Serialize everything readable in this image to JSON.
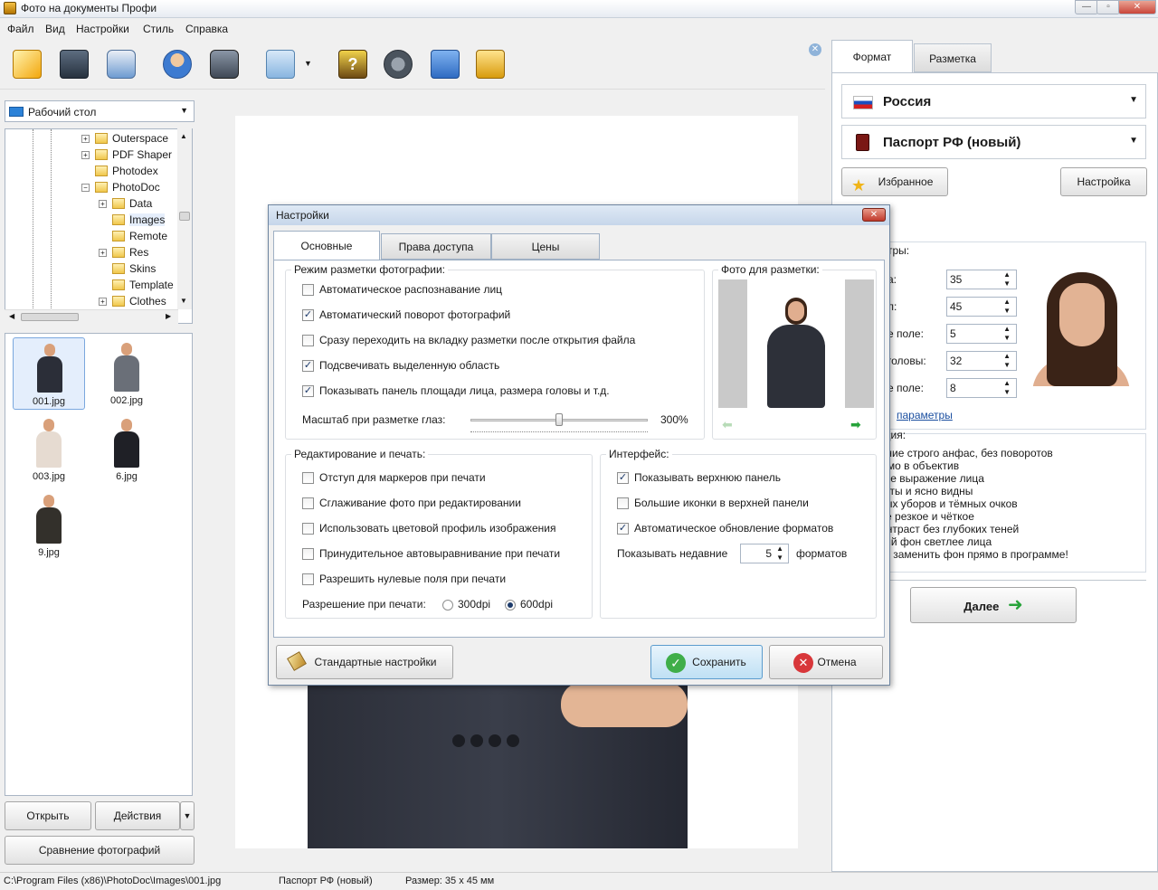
{
  "window": {
    "title": "Фото на документы Профи"
  },
  "menu": [
    "Файл",
    "Вид",
    "Настройки",
    "Стиль",
    "Справка"
  ],
  "toolbar_icons": [
    "open-icon",
    "save-icon",
    "print-icon",
    "user-icon",
    "camera-icon",
    "editor-icon",
    "help-icon",
    "video-icon",
    "home-icon",
    "cart-icon"
  ],
  "left": {
    "folder": "Рабочий стол",
    "tree": [
      {
        "label": "Outerspace",
        "level": 0,
        "expand": true
      },
      {
        "label": "PDF Shaper",
        "level": 0,
        "expand": true
      },
      {
        "label": "Photodex",
        "level": 0,
        "expand": false
      },
      {
        "label": "PhotoDoc",
        "level": 0,
        "expand": true,
        "open": true
      },
      {
        "label": "Data",
        "level": 1,
        "expand": true
      },
      {
        "label": "Images",
        "level": 1,
        "expand": false,
        "selected": true
      },
      {
        "label": "Remote",
        "level": 1,
        "expand": false
      },
      {
        "label": "Res",
        "level": 1,
        "expand": true
      },
      {
        "label": "Skins",
        "level": 1,
        "expand": false
      },
      {
        "label": "Template",
        "level": 1,
        "expand": false
      },
      {
        "label": "Clothes",
        "level": 1,
        "expand": true
      }
    ],
    "thumbs": [
      {
        "name": "001.jpg",
        "color": "#2b2e38"
      },
      {
        "name": "002.jpg",
        "color": "#6a6f78"
      },
      {
        "name": "003.jpg",
        "color": "#e6dbd1"
      },
      {
        "name": "6.jpg",
        "color": "#1f2026"
      },
      {
        "name": "9.jpg",
        "color": "#33302b"
      }
    ],
    "open_button": "Открыть",
    "actions_button": "Действия",
    "compare_button": "Сравнение фотографий"
  },
  "right": {
    "tab_format": "Формат",
    "tab_markup": "Разметка",
    "country": "Россия",
    "doc": "Паспорт РФ (новый)",
    "fav": "Избранное",
    "setup": "Настройка",
    "params_title": "тры:",
    "params": [
      {
        "label": "а:",
        "value": "35"
      },
      {
        "label": "л:",
        "value": "45"
      },
      {
        "label": "е поле:",
        "value": "5"
      },
      {
        "label": "головы:",
        "value": "32"
      },
      {
        "label": "е поле:",
        "value": "8"
      }
    ],
    "more_params": "параметры",
    "req_title": "ация:",
    "req_lines": [
      "ложение строго анфас, без поворотов",
      "д прямо в объектив",
      "альное выражение лица",
      "открыты и ясно видны",
      "ловных уборов и тёмных очков",
      "жение резкое и чёткое",
      "ий контраст без глубоких теней",
      "тонный фон светлее лица",
      "ожете заменить фон прямо в программе!"
    ],
    "next": "Далее"
  },
  "dialog": {
    "title": "Настройки",
    "tabs": [
      "Основные",
      "Права доступа",
      "Цены"
    ],
    "markup_group": "Режим разметки фотографии:",
    "markup_options": [
      {
        "label": "Автоматическое распознавание лиц",
        "checked": false
      },
      {
        "label": "Автоматический поворот фотографий",
        "checked": true
      },
      {
        "label": "Сразу переходить на вкладку разметки после открытия файла",
        "checked": false
      },
      {
        "label": "Подсвечивать выделенную область",
        "checked": true
      },
      {
        "label": "Показывать панель площади лица, размера головы и т.д.",
        "checked": true
      }
    ],
    "zoom_label": "Масштаб при разметке глаз:",
    "zoom_value": "300%",
    "zoom_level": 0.5,
    "photo_group": "Фото для разметки:",
    "edit_group": "Редактирование и печать:",
    "edit_options": [
      {
        "label": "Отступ для маркеров при печати",
        "checked": false
      },
      {
        "label": "Сглаживание фото при редактировании",
        "checked": false
      },
      {
        "label": "Использовать цветовой профиль изображения",
        "checked": false
      },
      {
        "label": "Принудительное автовыравнивание при печати",
        "checked": false
      },
      {
        "label": "Разрешить нулевые поля при печати",
        "checked": false
      }
    ],
    "dpi_label": "Разрешение при печати:",
    "dpi_300": "300dpi",
    "dpi_600": "600dpi",
    "dpi_selected": "600dpi",
    "ui_group": "Интерфейс:",
    "ui_options": [
      {
        "label": "Показывать верхнюю панель",
        "checked": true
      },
      {
        "label": "Большие иконки в верхней панели",
        "checked": false
      },
      {
        "label": "Автоматическое обновление форматов",
        "checked": true
      }
    ],
    "recent_label": "Показывать недавние",
    "recent_value": "5",
    "recent_suffix": "форматов",
    "default_btn": "Стандартные настройки",
    "save_btn": "Сохранить",
    "cancel_btn": "Отмена"
  },
  "status": {
    "path": "C:\\Program Files (x86)\\PhotoDoc\\Images\\001.jpg",
    "format": "Паспорт РФ (новый)",
    "size": "Размер: 35 x 45 мм"
  }
}
